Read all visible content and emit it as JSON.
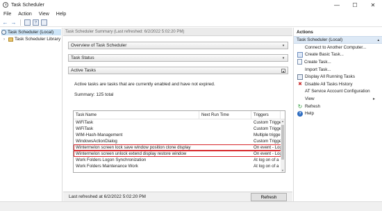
{
  "window": {
    "title": "Task Scheduler",
    "minimize_glyph": "—",
    "maximize_glyph": "☐",
    "close_glyph": "✕"
  },
  "menu": {
    "items": [
      "File",
      "Action",
      "View",
      "Help"
    ]
  },
  "toolbar": {
    "back_glyph": "←",
    "forward_glyph": "→",
    "help_glyph": "?",
    "icons": [
      "back-icon",
      "forward-icon",
      "console-tree-icon",
      "help-icon",
      "properties-icon"
    ]
  },
  "tree": {
    "root": "Task Scheduler (Local)",
    "child": "Task Scheduler Library",
    "expander_glyph": "›"
  },
  "summary": {
    "header": "Task Scheduler Summary (Last refreshed: 6/2/2022 5:02:20 PM)",
    "sections": [
      "Overview of Task Scheduler",
      "Task Status",
      "Active Tasks"
    ],
    "section_glyphs": [
      "▾",
      "▾",
      "▴"
    ],
    "description": "Active tasks are tasks that are currently enabled and have not expired.",
    "summary_text": "Summary: 125 total",
    "footer_text": "Last refreshed at 6/2/2022 5:02:20 PM",
    "refresh_button": "Refresh"
  },
  "task_table": {
    "columns": [
      "Task Name",
      "Next Run Time",
      "Triggers"
    ],
    "rows": [
      {
        "name": "WiFiTask",
        "next_run": "",
        "triggers": "Custom Trigge",
        "highlighted": false
      },
      {
        "name": "WiFiTask",
        "next_run": "",
        "triggers": "Custom Trigge",
        "highlighted": false
      },
      {
        "name": "WIM-Hash-Management",
        "next_run": "",
        "triggers": "Multiple trigge",
        "highlighted": false
      },
      {
        "name": "WindowsActionDialog",
        "next_run": "",
        "triggers": "Custom Trigge",
        "highlighted": false
      },
      {
        "name": "Wintermelon screen lock save window position clone display",
        "next_run": "",
        "triggers": "On event - Log",
        "highlighted": true
      },
      {
        "name": "Wintermelon screen unlock extend display restore window",
        "next_run": "",
        "triggers": "On event - Log",
        "highlighted": true
      },
      {
        "name": "Work Folders Logon Synchronization",
        "next_run": "",
        "triggers": "At log on of a",
        "highlighted": false
      },
      {
        "name": "Work Folders Maintenance Work",
        "next_run": "",
        "triggers": "At log on of a",
        "highlighted": false
      }
    ],
    "highlight_color": "#d6262a",
    "scroll_up_glyph": "▲",
    "scroll_down_glyph": "▼"
  },
  "actions": {
    "header": "Actions",
    "group": "Task Scheduler (Local)",
    "group_glyph": "▴",
    "submenu_glyph": "▸",
    "refresh_glyph": "↻",
    "delete_glyph": "✖",
    "help_glyph": "?",
    "items": [
      {
        "label": "Connect to Another Computer...",
        "icon": "blank"
      },
      {
        "label": "Create Basic Task...",
        "icon": "create-basic-task-icon"
      },
      {
        "label": "Create Task...",
        "icon": "create-task-icon"
      },
      {
        "label": "Import Task...",
        "icon": "blank"
      },
      {
        "label": "Display All Running Tasks",
        "icon": "running-tasks-icon"
      },
      {
        "label": "Disable All Tasks History",
        "icon": "history-icon"
      },
      {
        "label": "AT Service Account Configuration",
        "icon": "blank"
      },
      {
        "label": "View",
        "icon": "blank"
      },
      {
        "label": "Refresh",
        "icon": "refresh-icon"
      },
      {
        "label": "Help",
        "icon": "help-icon"
      }
    ]
  },
  "colors": {
    "selection": "#cce4f7",
    "actions_group_bg": "#dde9f6",
    "highlight_outline": "#d6262a"
  }
}
